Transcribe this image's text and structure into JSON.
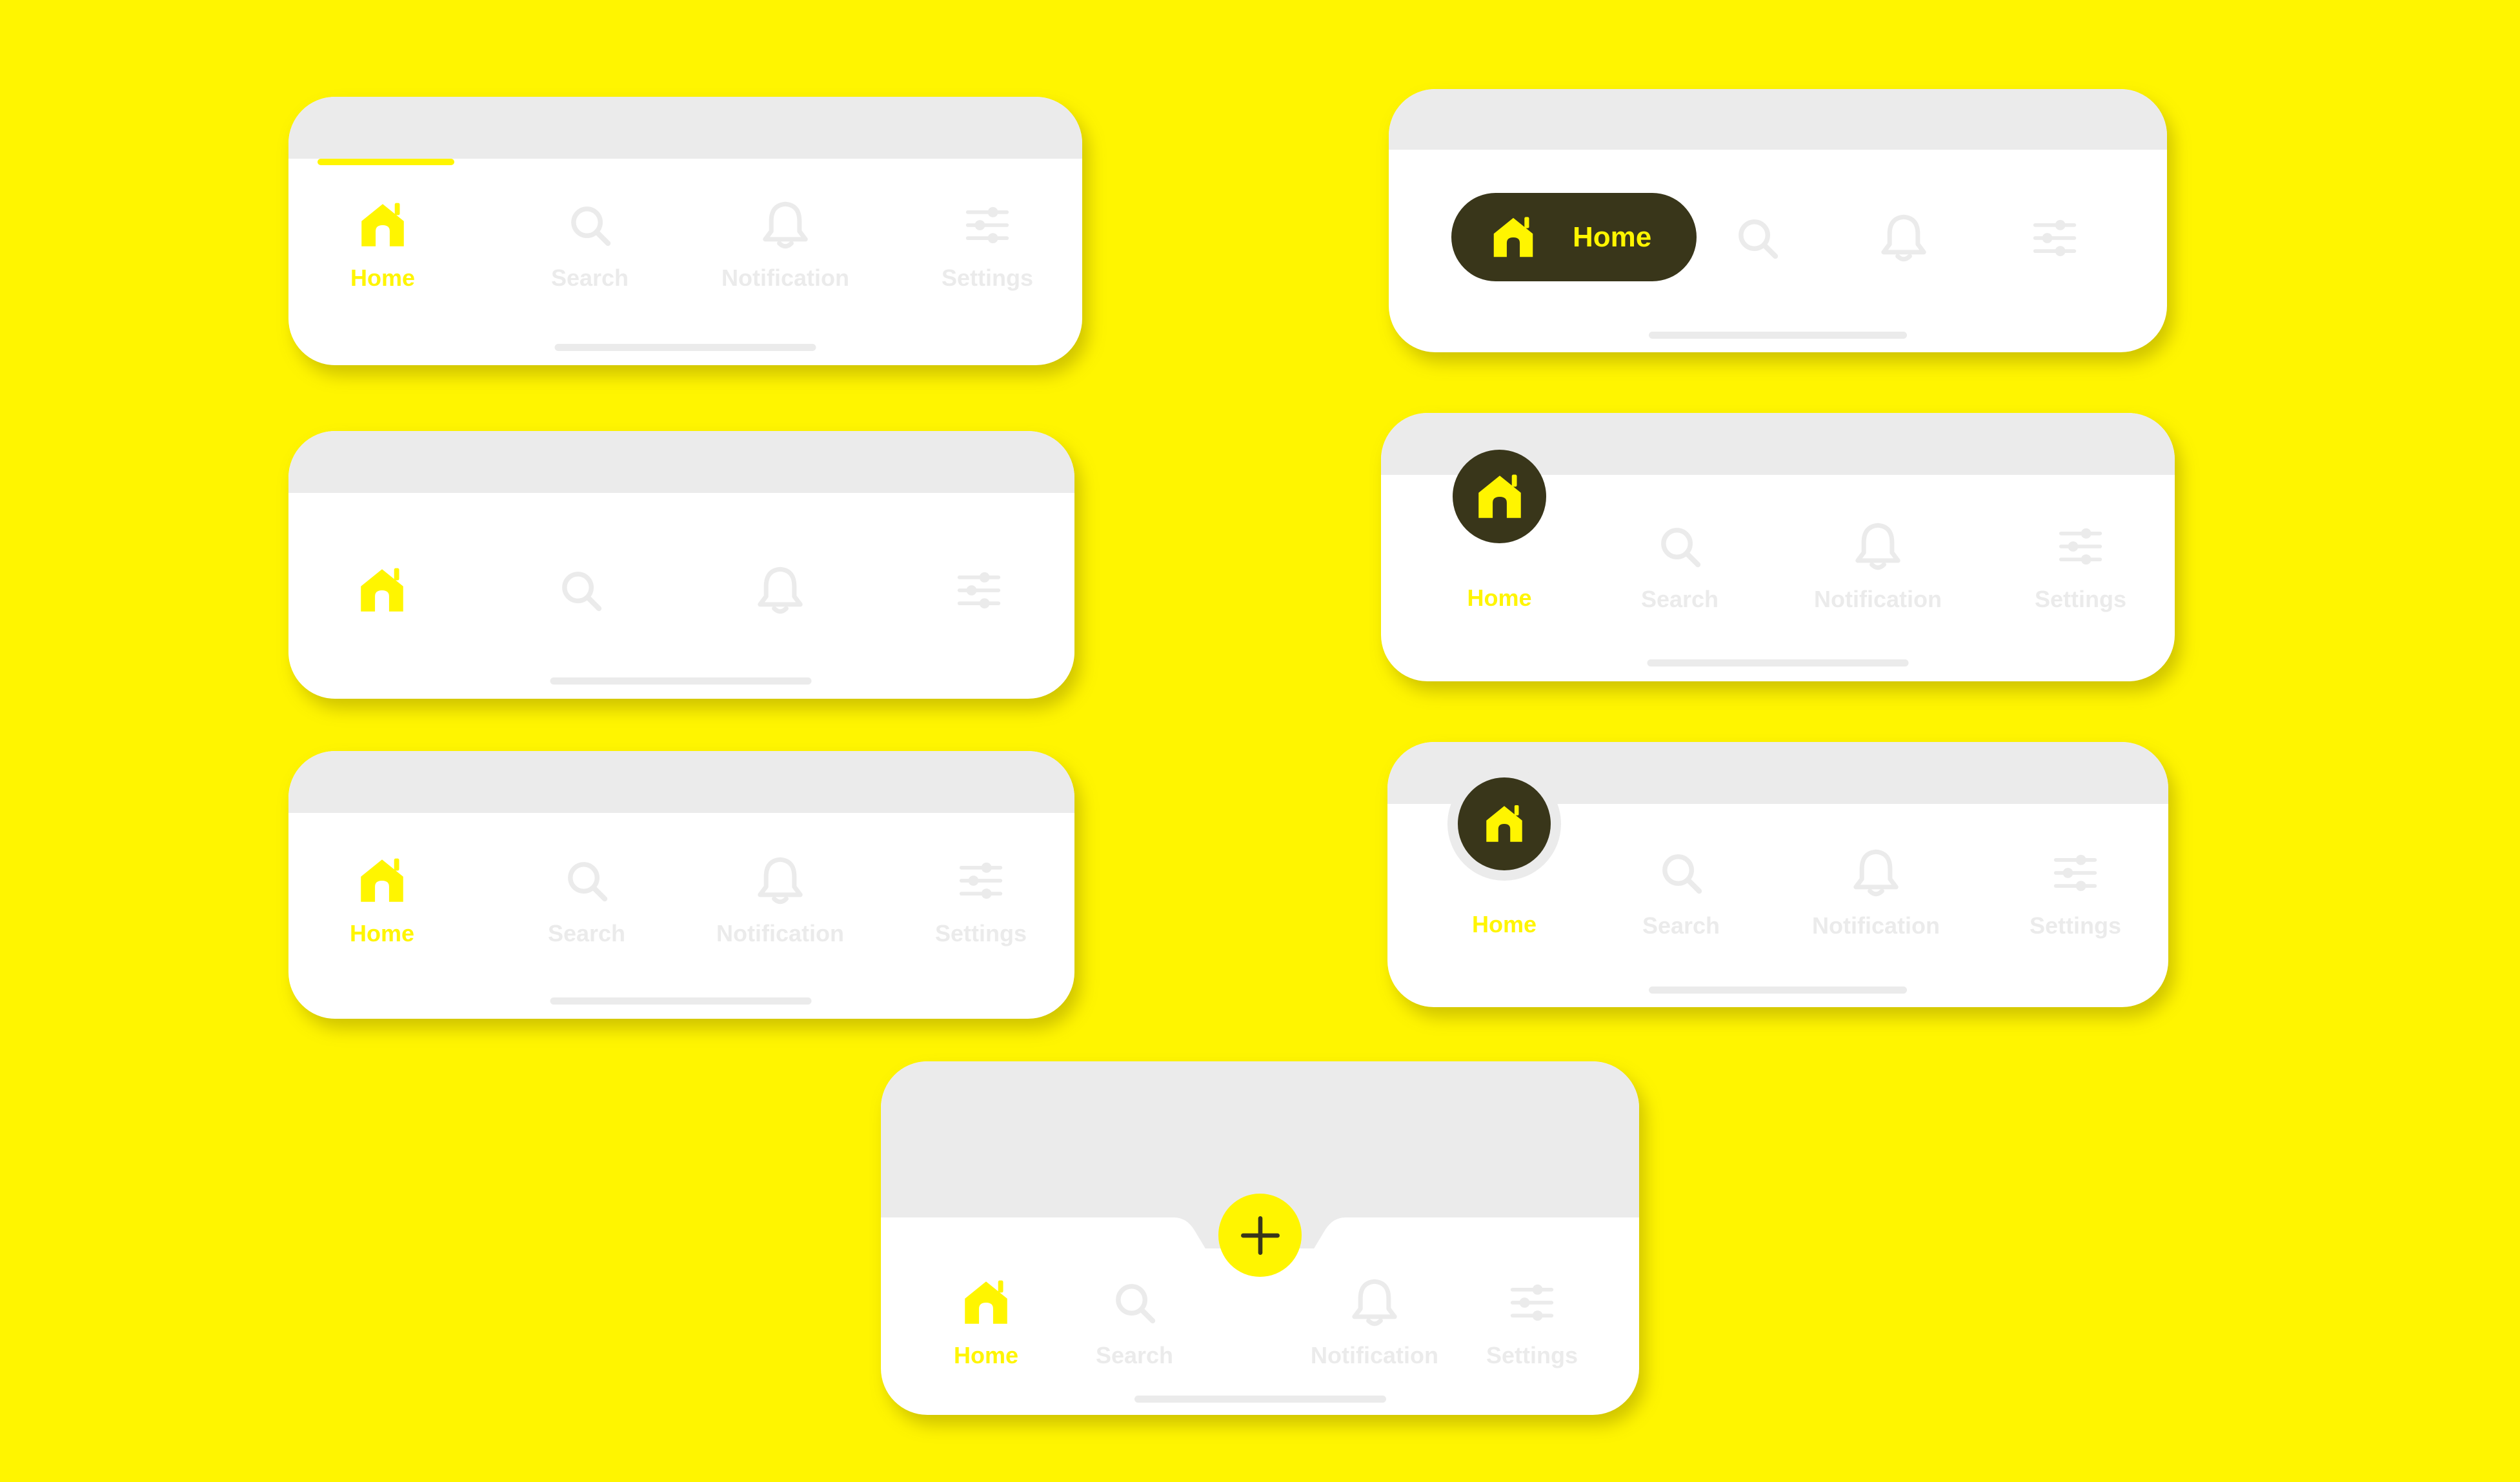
{
  "colors": {
    "background": "#FFF500",
    "accent": "#FFF500",
    "surface": "#FFFFFF",
    "muted": "#EBEBEB",
    "dark": "#39361A"
  },
  "tabs": [
    {
      "label": "Home",
      "icon": "home-icon"
    },
    {
      "label": "Search",
      "icon": "search-icon"
    },
    {
      "label": "Notification",
      "icon": "bell-icon"
    },
    {
      "label": "Settings",
      "icon": "sliders-icon"
    }
  ],
  "pill_bar": {
    "active_label": "Home"
  },
  "fab": {
    "icon": "plus-icon"
  }
}
